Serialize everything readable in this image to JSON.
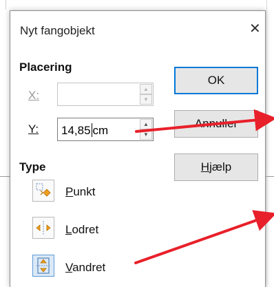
{
  "dialog": {
    "title": "Nyt fangobjekt",
    "close_glyph": "✕",
    "close_icon": "close-icon"
  },
  "placement": {
    "heading": "Placering",
    "x_label": "X:",
    "x_value": "",
    "y_label": "Y:",
    "y_value_before_caret": "14,85",
    "y_value_after_caret": "cm"
  },
  "type": {
    "heading": "Type",
    "options": [
      {
        "label": "Punkt",
        "icon": "point-icon",
        "selected": false
      },
      {
        "label": "Lodret",
        "icon": "vertical-line-icon",
        "selected": false
      },
      {
        "label": "Vandret",
        "icon": "horizontal-line-icon",
        "selected": true
      }
    ]
  },
  "buttons": {
    "ok": "OK",
    "annuller": "Annuller",
    "hjaelp_first": "H",
    "hjaelp_rest": "jælp"
  },
  "colors": {
    "accent": "#0078d7",
    "annotation_arrow": "#e8202a",
    "snap_icon_orange": "#f0a020",
    "selected_bg": "#dbe9f7"
  }
}
